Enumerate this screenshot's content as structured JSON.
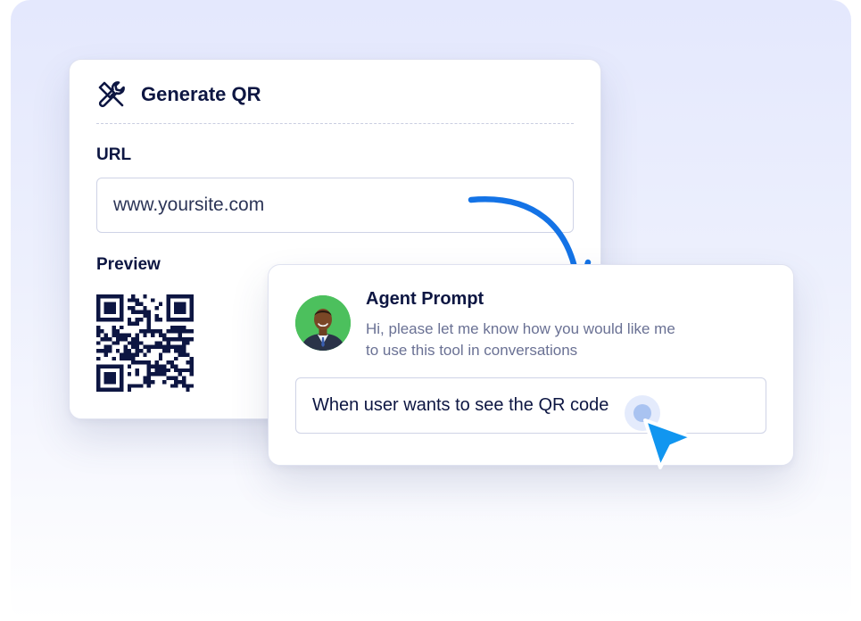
{
  "qr_tool": {
    "title": "Generate QR",
    "icon": "wrench-screwdriver-icon",
    "url_label": "URL",
    "url_value": "www.yoursite.com",
    "preview_label": "Preview"
  },
  "agent_prompt": {
    "title": "Agent Prompt",
    "description_line1": "Hi, please let me know how you would like me",
    "description_line2": "to use this tool in conversations",
    "input_value": "When user wants to see the QR code"
  },
  "colors": {
    "accent_blue": "#1473e6",
    "title_text": "#0d1642",
    "avatar_bg": "#4cc05d"
  }
}
